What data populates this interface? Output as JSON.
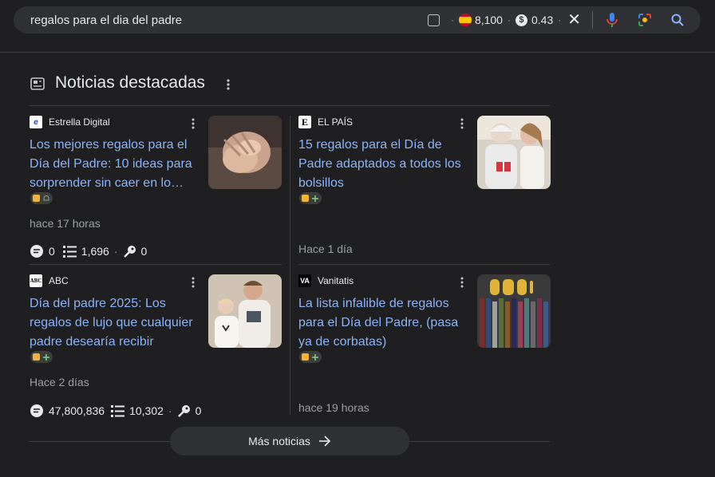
{
  "search": {
    "query": "regalos para el dia del padre",
    "volume": "8,100",
    "cpc": "0.43"
  },
  "section": {
    "title": "Noticias destacadas"
  },
  "articles": [
    {
      "source": "Estrella Digital",
      "headline": "Los mejores regalos para el Día del Padre: 10 ideas para sorprender sin caer en lo…",
      "time": "hace 17 horas",
      "comments": "0",
      "links": "1,696",
      "keywords": "0"
    },
    {
      "source": "EL PAÍS",
      "headline": "15 regalos para el Día de Padre adaptados a todos los bolsillos",
      "time": "Hace 1 día"
    },
    {
      "source": "ABC",
      "headline": "Día del padre 2025: Los regalos de lujo que cualquier padre desearía recibir",
      "time": "Hace 2 días",
      "comments": "47,800,836",
      "links": "10,302",
      "keywords": "0"
    },
    {
      "source": "Vanitatis",
      "headline": "La lista infalible de regalos para el Día del Padre, (pasa ya de corbatas)",
      "time": "hace 19 horas"
    }
  ],
  "more_button": {
    "label": "Más noticias"
  },
  "colors": {
    "link": "#8ab4f8",
    "background": "#1f1f22",
    "search_bg": "#303134"
  }
}
